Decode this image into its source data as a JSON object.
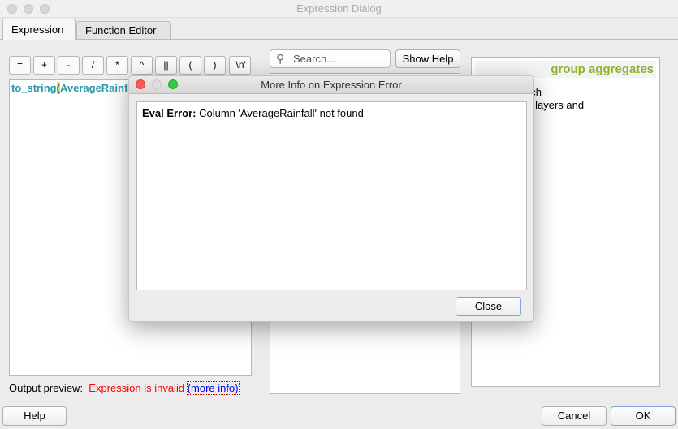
{
  "window": {
    "title": "Expression Dialog"
  },
  "tabs": [
    {
      "label": "Expression",
      "active": true
    },
    {
      "label": "Function Editor",
      "active": false
    }
  ],
  "operators": [
    "=",
    "+",
    "-",
    "/",
    "*",
    "^",
    "||",
    "(",
    ")",
    "'\\n'"
  ],
  "editor": {
    "expression_prefix": "to_string",
    "expression_bracket": "(",
    "expression_rest": "AverageRainfa"
  },
  "search": {
    "placeholder": "Search...",
    "icon": "search-icon"
  },
  "show_help_label": "Show Help",
  "help_panel": {
    "title": "group aggregates",
    "body_line1": "nctions which",
    "body_line2": "values over layers and",
    "title_color": "#8db52a"
  },
  "output": {
    "label": "Output preview:",
    "status": "Expression is invalid",
    "more_info": "(more info)",
    "status_color": "#ff0000"
  },
  "buttons": {
    "help": "Help",
    "cancel": "Cancel",
    "ok": "OK"
  },
  "error_dialog": {
    "title": "More Info on Expression Error",
    "error_label": "Eval Error:",
    "error_message": "Column 'AverageRainfall' not found",
    "close": "Close"
  }
}
